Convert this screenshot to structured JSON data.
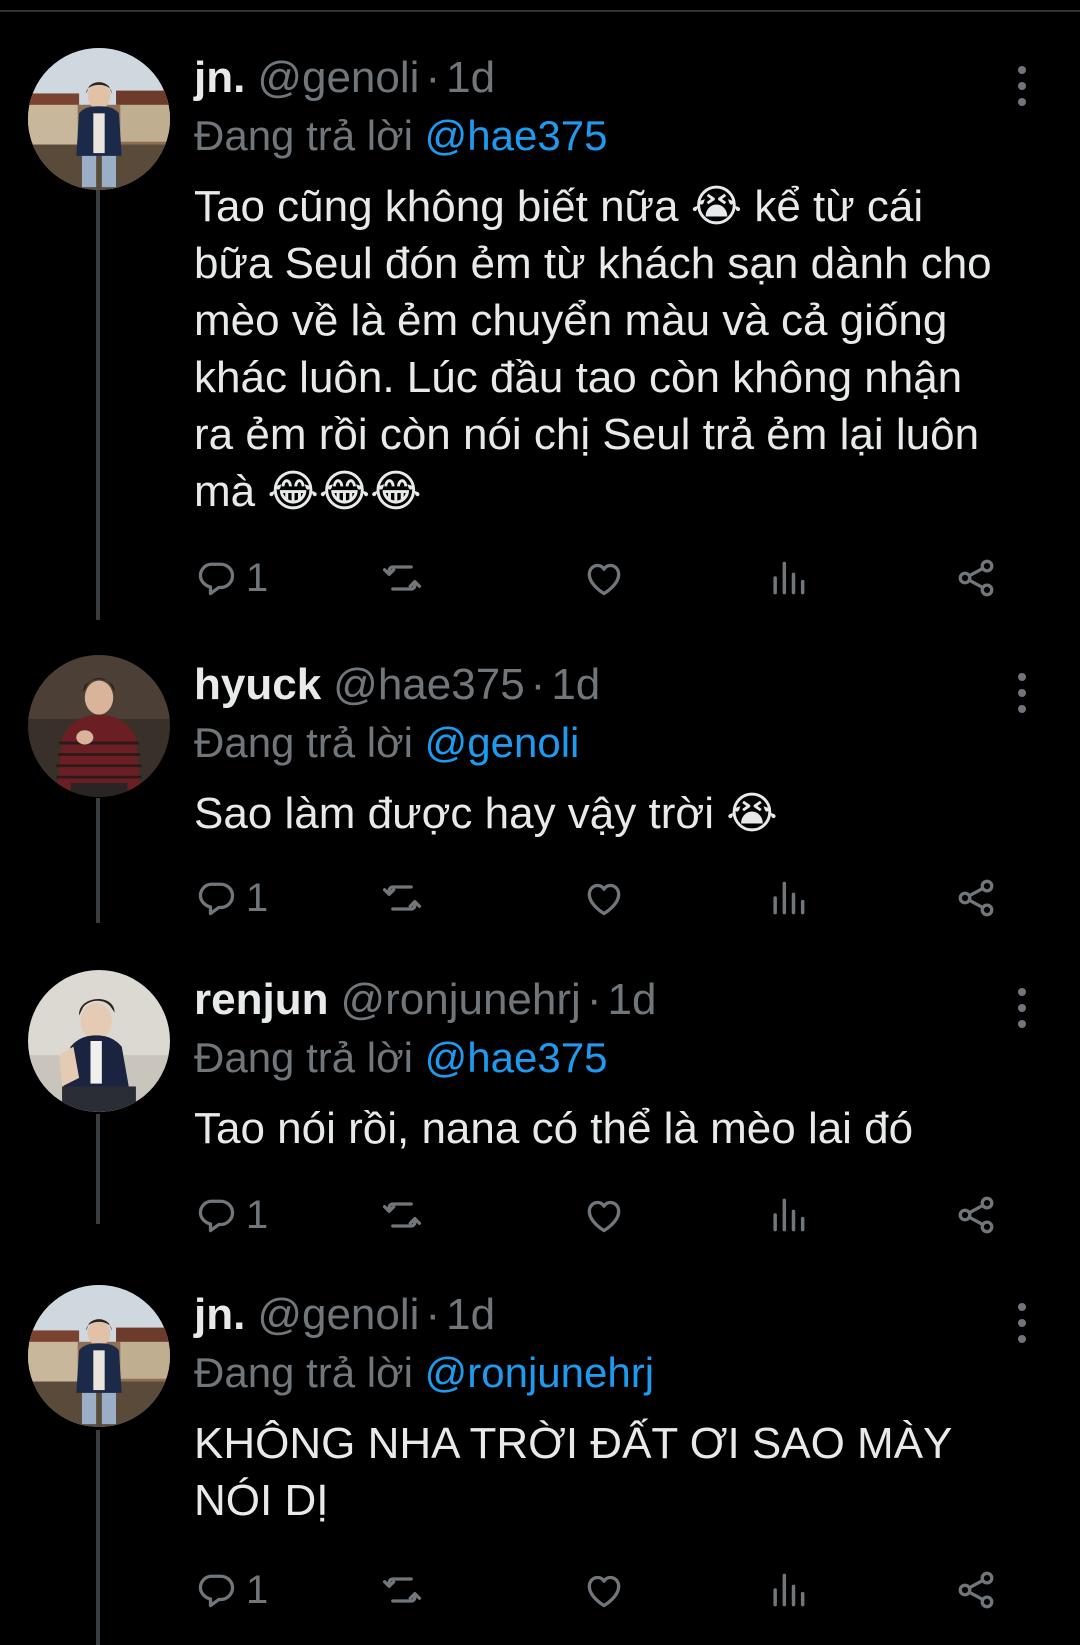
{
  "colors": {
    "background": "#000000",
    "text": "#e7e9ea",
    "muted": "#71767b",
    "accent": "#1d9bf0",
    "thread_line": "#3a3d40"
  },
  "reply_prefix": "Đang trả lời",
  "tweets": [
    {
      "name": "jn.",
      "handle": "@genoli",
      "separator": "·",
      "time": "1d",
      "replying_to": "@hae375",
      "text": "Tao cũng không biết nữa 😭 kể từ cái bữa Seul đón ẻm từ khách sạn dành cho mèo về là ẻm chuyển màu và cả giống khác luôn. Lúc đầu tao còn không nhận ra ẻm rồi còn nói chị Seul trả ẻm lại luôn mà 😂😂😂",
      "reply_count": "1",
      "icons": [
        "reply-icon",
        "retweet-icon",
        "like-icon",
        "views-icon",
        "share-icon",
        "more-icon"
      ]
    },
    {
      "name": "hyuck",
      "handle": "@hae375",
      "separator": "·",
      "time": "1d",
      "replying_to": "@genoli",
      "text": "Sao làm được hay vậy trời 😭",
      "reply_count": "1",
      "icons": [
        "reply-icon",
        "retweet-icon",
        "like-icon",
        "views-icon",
        "share-icon",
        "more-icon"
      ]
    },
    {
      "name": "renjun",
      "handle": "@ronjunehrj",
      "separator": "·",
      "time": "1d",
      "replying_to": "@hae375",
      "text": "Tao nói rồi, nana có thể là mèo lai đó",
      "reply_count": "1",
      "icons": [
        "reply-icon",
        "retweet-icon",
        "like-icon",
        "views-icon",
        "share-icon",
        "more-icon"
      ]
    },
    {
      "name": "jn.",
      "handle": "@genoli",
      "separator": "·",
      "time": "1d",
      "replying_to": "@ronjunehrj",
      "text": "KHÔNG NHA TRỜI ĐẤT ƠI SAO MÀY NÓI DỊ",
      "reply_count": "1",
      "icons": [
        "reply-icon",
        "retweet-icon",
        "like-icon",
        "views-icon",
        "share-icon",
        "more-icon"
      ]
    }
  ]
}
